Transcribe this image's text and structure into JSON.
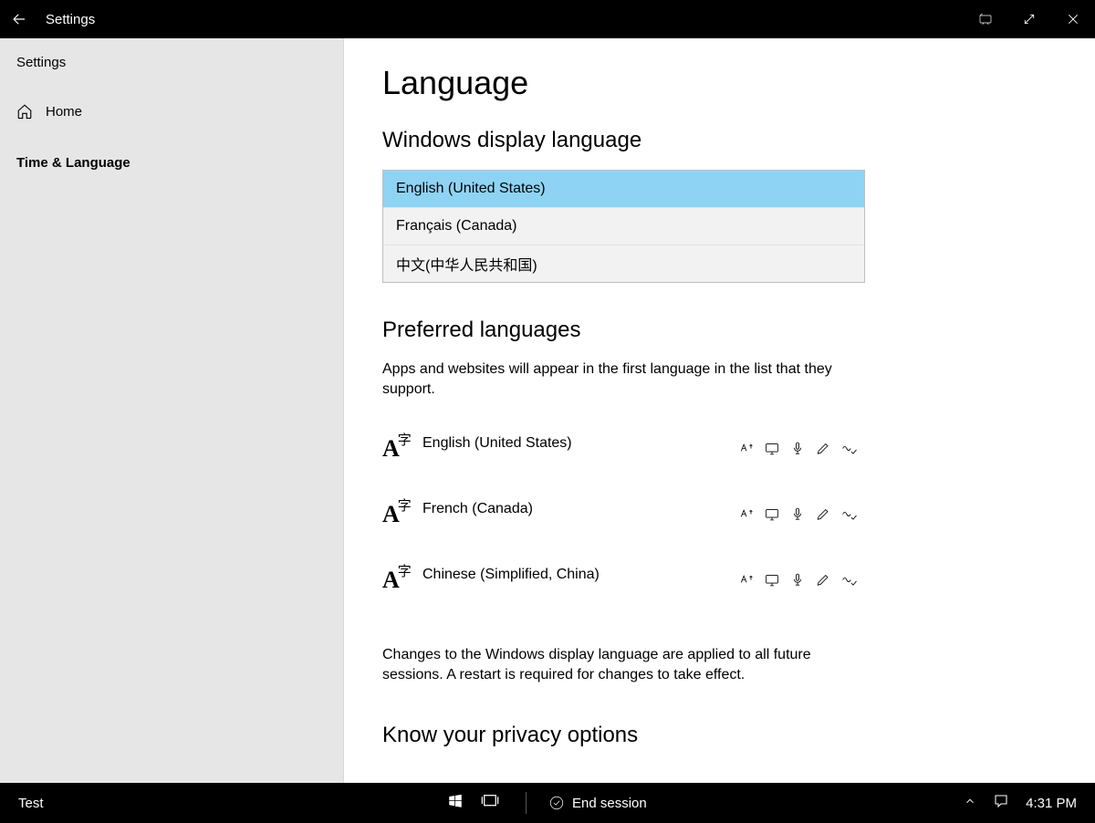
{
  "titlebar": {
    "title": "Settings"
  },
  "sidebar": {
    "app_label": "Settings",
    "home": "Home",
    "category": "Time & Language"
  },
  "main": {
    "page_title": "Language",
    "display_heading": "Windows display language",
    "display_options": [
      "English (United States)",
      "Français (Canada)",
      "中文(中华人民共和国)"
    ],
    "preferred_heading": "Preferred languages",
    "preferred_desc": "Apps and websites will appear in the first language in the list that they support.",
    "preferred_langs": [
      "English (United States)",
      "French (Canada)",
      "Chinese (Simplified, China)"
    ],
    "note": "Changes to the Windows display language are applied to all future sessions. A restart is required for changes to take effect.",
    "privacy_heading": "Know your privacy options"
  },
  "taskbar": {
    "user": "Test",
    "end_session": "End session",
    "clock": "4:31 PM"
  }
}
